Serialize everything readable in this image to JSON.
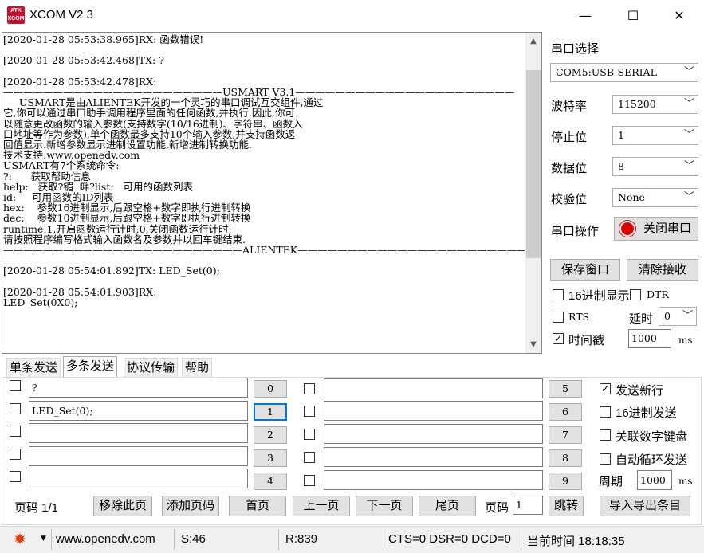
{
  "window": {
    "logo_text": "ATK XCOM",
    "title": "XCOM V2.3",
    "minimize": "—",
    "maximize": "☐",
    "close": "✕"
  },
  "receive": {
    "text": "[2020-01-28 05:53:38.965]RX: 函数错误!\n\n[2020-01-28 05:53:42.468]TX: ?\n\n[2020-01-28 05:53:42.478]RX:\n——————————————————————USMART V3.1——————————————————————\n     USMART是由ALIENTEK开发的一个灵巧的串口调试互交组件,通过\n它,你可以通过串口助手调用程序里面的任何函数,并执行.因此,你可\n以随意更改函数的输入参数(支持数字(10/16进制)、字符串、函数入\n口地址等作为参数),单个函数最多支持10个输入参数,并支持函数返\n回值显示.新增参数显示进制设置功能,新增进制转换功能.\n技术支持:www.openedv.com\nUSMART有7个系统命令:\n?:      获取帮助信息\nhelp:   获取?镅  畔?list:   可用的函数列表\nid:     可用函数的ID列表\nhex:    参数16进制显示,后跟空格+数字即执行进制转换\ndec:    参数10进制显示,后跟空格+数字即执行进制转换\nruntime:1,开启函数运行计时;0,关闭函数运行计时;\n请按照程序编写格式输入函数名及参数并以回车键结束.\n————————————————————————ALIENTEK————————————————————————\n\n[2020-01-28 05:54:01.892]TX: LED_Set(0);\n\n[2020-01-28 05:54:01.903]RX:\nLED_Set(0X0);"
  },
  "serial": {
    "section_label": "串口选择",
    "port_value": "COM5:USB-SERIAL",
    "baud_label": "波特率",
    "baud_value": "115200",
    "stop_label": "停止位",
    "stop_value": "1",
    "data_label": "数据位",
    "data_value": "8",
    "parity_label": "校验位",
    "parity_value": "None",
    "op_label": "串口操作",
    "op_button": "关闭串口",
    "save_window": "保存窗口",
    "clear_receive": "清除接收",
    "hex_display": "16进制显示",
    "dtr": "DTR",
    "rts": "RTS",
    "delay_label": "延时",
    "delay_value": "0",
    "timestamp": "时间戳",
    "timestamp_value": "1000",
    "ms": "ms"
  },
  "tabs": [
    "单条发送",
    "多条发送",
    "协议传输",
    "帮助"
  ],
  "multi_send": {
    "left_rows": [
      {
        "text": "?",
        "num": "0"
      },
      {
        "text": "LED_Set(0);",
        "num": "1"
      },
      {
        "text": "",
        "num": "2"
      },
      {
        "text": "",
        "num": "3"
      },
      {
        "text": "",
        "num": "4"
      }
    ],
    "right_rows": [
      {
        "text": "",
        "num": "5"
      },
      {
        "text": "",
        "num": "6"
      },
      {
        "text": "",
        "num": "7"
      },
      {
        "text": "",
        "num": "8"
      },
      {
        "text": "",
        "num": "9"
      }
    ],
    "send_newline": "发送新行",
    "hex_send": "16进制发送",
    "link_keypad": "关联数字键盘",
    "auto_loop": "自动循环发送",
    "period_label": "周期",
    "period_value": "1000",
    "ms": "ms"
  },
  "bottom": {
    "page_info": "页码 1/1",
    "remove_page": "移除此页",
    "add_page": "添加页码",
    "first_page": "首页",
    "prev_page": "上一页",
    "next_page": "下一页",
    "last_page": "尾页",
    "page_label": "页码",
    "page_value": "1",
    "jump": "跳转",
    "import_export": "导入导出条目"
  },
  "status": {
    "url": "www.openedv.com",
    "sent": "S:46",
    "received": "R:839",
    "lines": "CTS=0 DSR=0 DCD=0",
    "time": "当前时间 18:18:35"
  }
}
